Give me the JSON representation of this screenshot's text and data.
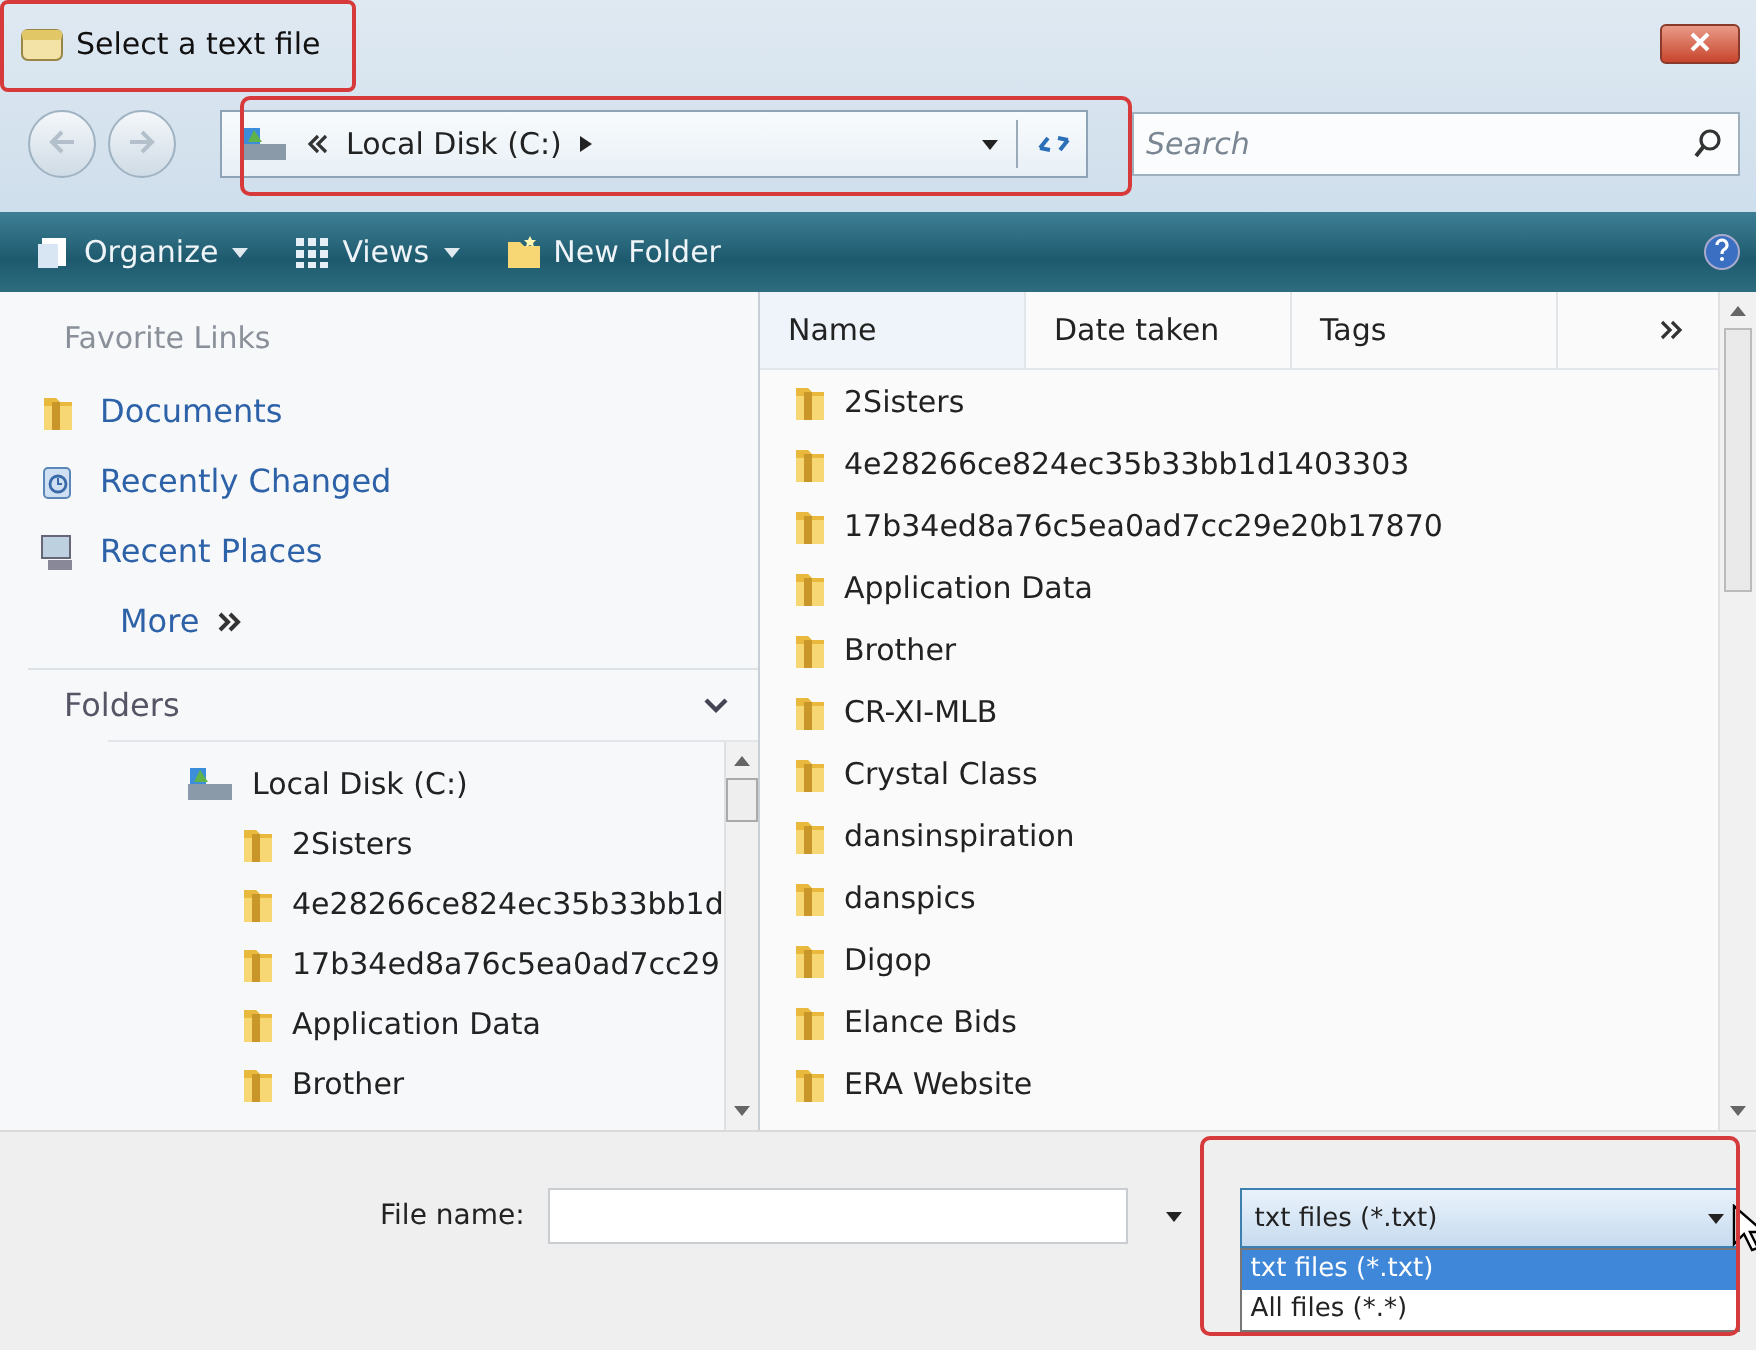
{
  "window": {
    "title": "Select a text file"
  },
  "address_bar": {
    "path": "Local Disk (C:)"
  },
  "search": {
    "placeholder": "Search"
  },
  "toolbar": {
    "items": [
      {
        "label": "Organize",
        "kind": "organize",
        "dropdown": true
      },
      {
        "label": "Views",
        "kind": "views",
        "dropdown": true
      },
      {
        "label": "New Folder",
        "kind": "new-folder",
        "dropdown": false
      }
    ]
  },
  "favorite_links": {
    "title": "Favorite Links",
    "items": [
      {
        "label": "Documents",
        "kind": "folder"
      },
      {
        "label": "Recently Changed",
        "kind": "recent"
      },
      {
        "label": "Recent Places",
        "kind": "places"
      }
    ],
    "more": "More"
  },
  "folders": {
    "title": "Folders",
    "tree": [
      {
        "label": "Local Disk (C:)",
        "kind": "drive",
        "children": [
          {
            "label": "2Sisters",
            "kind": "folder"
          },
          {
            "label": "4e28266ce824ec35b33bb1d",
            "kind": "folder"
          },
          {
            "label": "17b34ed8a76c5ea0ad7cc29",
            "kind": "folder"
          },
          {
            "label": "Application Data",
            "kind": "folder"
          },
          {
            "label": "Brother",
            "kind": "folder"
          }
        ]
      }
    ]
  },
  "file_list": {
    "columns": [
      "Name",
      "Date taken",
      "Tags"
    ],
    "items": [
      "2Sisters",
      "4e28266ce824ec35b33bb1d1403303",
      "17b34ed8a76c5ea0ad7cc29e20b17870",
      "Application Data",
      "Brother",
      "CR-XI-MLB",
      "Crystal Class",
      "dansinspiration",
      "danspics",
      "Digop",
      "Elance Bids",
      "ERA Website"
    ]
  },
  "file_name": {
    "label": "File name:"
  },
  "file_type": {
    "value": "txt files (*.txt)",
    "expanded": true,
    "options": [
      {
        "label": "txt files (*.txt)",
        "selected": true
      },
      {
        "label": "All files (*.*)",
        "selected": false
      }
    ]
  }
}
